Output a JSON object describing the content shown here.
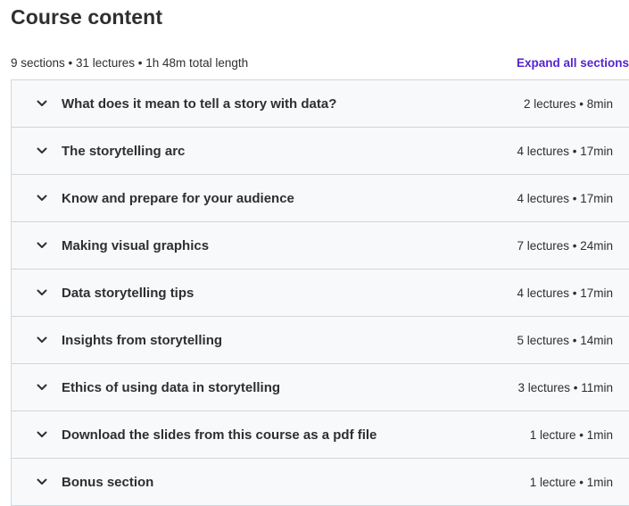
{
  "header": {
    "title": "Course content",
    "summary": "9 sections • 31 lectures • 1h 48m total length",
    "expand_label": "Expand all sections"
  },
  "icons": {
    "section_toggle": "chevron-down-icon"
  },
  "colors": {
    "link": "#5624d0",
    "section_bg": "#f7f9fa",
    "border": "#d1d7dc",
    "text": "#2d2f31"
  },
  "sections": [
    {
      "title": "What does it mean to tell a story with data?",
      "meta": "2 lectures • 8min"
    },
    {
      "title": "The storytelling arc",
      "meta": "4 lectures • 17min"
    },
    {
      "title": "Know and prepare for your audience",
      "meta": "4 lectures • 17min"
    },
    {
      "title": "Making visual graphics",
      "meta": "7 lectures • 24min"
    },
    {
      "title": "Data storytelling tips",
      "meta": "4 lectures • 17min"
    },
    {
      "title": "Insights from storytelling",
      "meta": "5 lectures • 14min"
    },
    {
      "title": "Ethics of using data in storytelling",
      "meta": "3 lectures • 11min"
    },
    {
      "title": "Download the slides from this course as a pdf file",
      "meta": "1 lecture • 1min"
    },
    {
      "title": "Bonus section",
      "meta": "1 lecture • 1min"
    }
  ]
}
